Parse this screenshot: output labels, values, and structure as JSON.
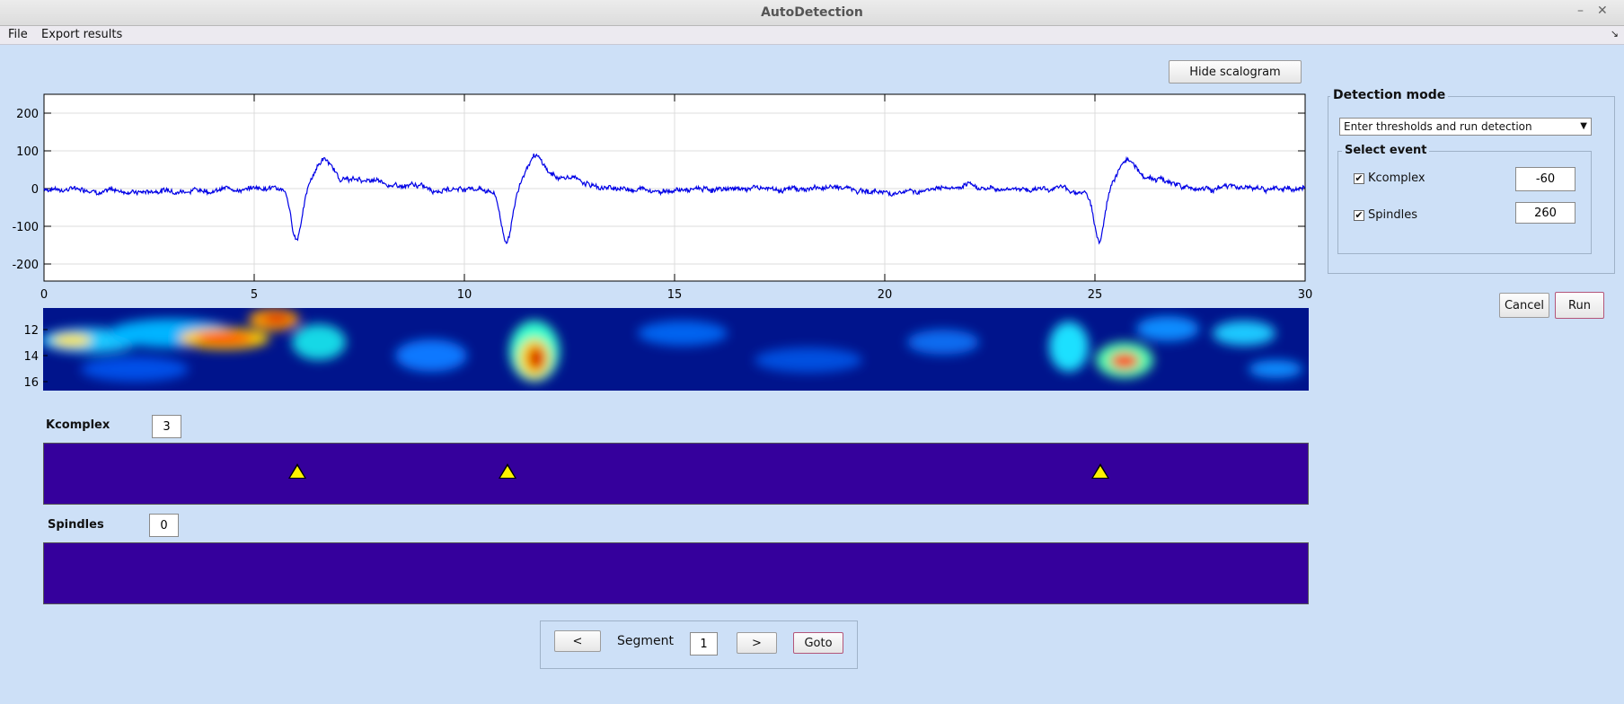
{
  "window": {
    "title": "AutoDetection",
    "minimize_glyph": "–",
    "close_glyph": "✕"
  },
  "menu": {
    "items": [
      "File",
      "Export results"
    ],
    "resize_glyph": "↘"
  },
  "toolbar": {
    "hide_scalogram_label": "Hide scalogram"
  },
  "signal_plot": {
    "xticks": [
      "0",
      "5",
      "10",
      "15",
      "20",
      "25",
      "30"
    ],
    "yticks": [
      "200",
      "100",
      "0",
      "-100",
      "-200"
    ],
    "line_color": "#0000e6"
  },
  "scalogram": {
    "yticks": [
      "12",
      "14",
      "16"
    ]
  },
  "events": {
    "kcomplex": {
      "label": "Kcomplex",
      "count": "3",
      "marker_times": [
        6.0,
        11.0,
        25.1
      ]
    },
    "spindles": {
      "label": "Spindles",
      "count": "0",
      "marker_times": []
    },
    "bar_color": "#35009c",
    "marker_color": "#fff200"
  },
  "navigation": {
    "prev_label": "<",
    "segment_label": "Segment",
    "segment_value": "1",
    "next_label": ">",
    "goto_label": "Goto"
  },
  "detection": {
    "panel_title": "Detection mode",
    "mode_value": "Enter thresholds and run detection",
    "select_event_title": "Select event",
    "events": [
      {
        "label": "Kcomplex",
        "checked": true,
        "threshold": "-60"
      },
      {
        "label": "Spindles",
        "checked": true,
        "threshold": "260"
      }
    ],
    "check_glyph": "✔"
  },
  "actions": {
    "cancel_label": "Cancel",
    "run_label": "Run"
  }
}
